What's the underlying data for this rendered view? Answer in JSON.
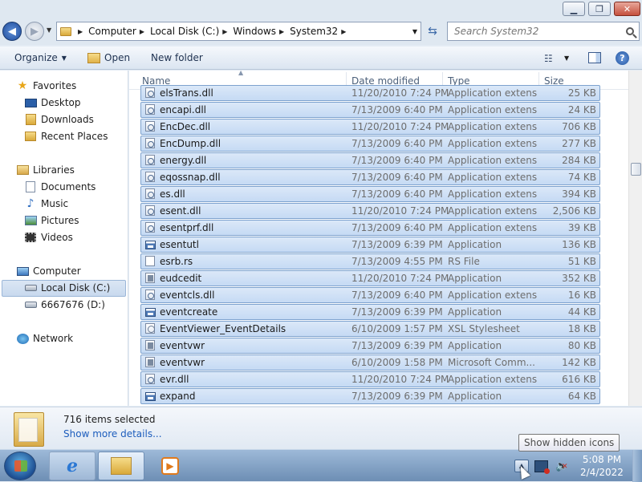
{
  "window": {
    "min_label": "▁",
    "max_label": "❐",
    "close_label": "✕"
  },
  "address": {
    "crumbs": [
      "Computer",
      "Local Disk (C:)",
      "Windows",
      "System32"
    ],
    "search_placeholder": "Search System32"
  },
  "toolbar": {
    "organize": "Organize",
    "open": "Open",
    "new_folder": "New folder",
    "help_label": "?"
  },
  "nav": {
    "favorites": "Favorites",
    "desktop": "Desktop",
    "downloads": "Downloads",
    "recent_places": "Recent Places",
    "libraries": "Libraries",
    "documents": "Documents",
    "music": "Music",
    "pictures": "Pictures",
    "videos": "Videos",
    "computer": "Computer",
    "local_disk": "Local Disk (C:)",
    "drive_d": "6667676 (D:)",
    "network": "Network"
  },
  "columns": {
    "name": "Name",
    "date_modified": "Date modified",
    "type": "Type",
    "size": "Size"
  },
  "files": [
    {
      "name": "elsTrans.dll",
      "date": "11/20/2010 7:24 PM",
      "type": "Application extens...",
      "size": "25 KB",
      "icon": "dll"
    },
    {
      "name": "encapi.dll",
      "date": "7/13/2009 6:40 PM",
      "type": "Application extens...",
      "size": "24 KB",
      "icon": "dll"
    },
    {
      "name": "EncDec.dll",
      "date": "11/20/2010 7:24 PM",
      "type": "Application extens...",
      "size": "706 KB",
      "icon": "dll"
    },
    {
      "name": "EncDump.dll",
      "date": "7/13/2009 6:40 PM",
      "type": "Application extens...",
      "size": "277 KB",
      "icon": "dll"
    },
    {
      "name": "energy.dll",
      "date": "7/13/2009 6:40 PM",
      "type": "Application extens...",
      "size": "284 KB",
      "icon": "dll"
    },
    {
      "name": "eqossnap.dll",
      "date": "7/13/2009 6:40 PM",
      "type": "Application extens...",
      "size": "74 KB",
      "icon": "dll"
    },
    {
      "name": "es.dll",
      "date": "7/13/2009 6:40 PM",
      "type": "Application extens...",
      "size": "394 KB",
      "icon": "dll"
    },
    {
      "name": "esent.dll",
      "date": "11/20/2010 7:24 PM",
      "type": "Application extens...",
      "size": "2,506 KB",
      "icon": "dll"
    },
    {
      "name": "esentprf.dll",
      "date": "7/13/2009 6:40 PM",
      "type": "Application extens...",
      "size": "39 KB",
      "icon": "dll"
    },
    {
      "name": "esentutl",
      "date": "7/13/2009 6:39 PM",
      "type": "Application",
      "size": "136 KB",
      "icon": "exe"
    },
    {
      "name": "esrb.rs",
      "date": "7/13/2009 4:55 PM",
      "type": "RS File",
      "size": "51 KB",
      "icon": "blank"
    },
    {
      "name": "eudcedit",
      "date": "11/20/2010 7:24 PM",
      "type": "Application",
      "size": "352 KB",
      "icon": "msc"
    },
    {
      "name": "eventcls.dll",
      "date": "7/13/2009 6:40 PM",
      "type": "Application extens...",
      "size": "16 KB",
      "icon": "dll"
    },
    {
      "name": "eventcreate",
      "date": "7/13/2009 6:39 PM",
      "type": "Application",
      "size": "44 KB",
      "icon": "exe"
    },
    {
      "name": "EventViewer_EventDetails",
      "date": "6/10/2009 1:57 PM",
      "type": "XSL Stylesheet",
      "size": "18 KB",
      "icon": "xsl"
    },
    {
      "name": "eventvwr",
      "date": "7/13/2009 6:39 PM",
      "type": "Application",
      "size": "80 KB",
      "icon": "msc"
    },
    {
      "name": "eventvwr",
      "date": "6/10/2009 1:58 PM",
      "type": "Microsoft Comm...",
      "size": "142 KB",
      "icon": "msc"
    },
    {
      "name": "evr.dll",
      "date": "11/20/2010 7:24 PM",
      "type": "Application extens...",
      "size": "616 KB",
      "icon": "dll"
    },
    {
      "name": "expand",
      "date": "7/13/2009 6:39 PM",
      "type": "Application",
      "size": "64 KB",
      "icon": "exe"
    }
  ],
  "details": {
    "selected_count": "716 items selected",
    "show_more": "Show more details..."
  },
  "taskbar": {
    "time": "5:08 PM",
    "date": "2/4/2022",
    "ie_glyph": "e",
    "tray_arrow": "▲",
    "volume_glyph": "🔈"
  },
  "tooltip": {
    "text": "Show hidden icons"
  }
}
